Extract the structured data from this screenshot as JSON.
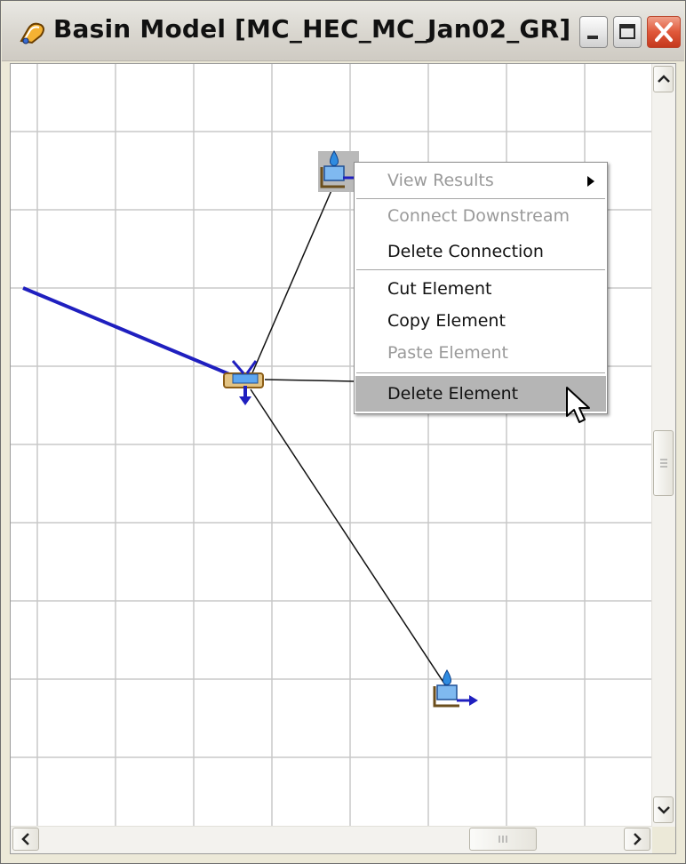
{
  "window": {
    "title": "Basin Model [MC_HEC_MC_Jan02_GR]",
    "icon": "basin-model-icon"
  },
  "titlebar_buttons": [
    {
      "name": "minimize-button",
      "icon": "minimize-icon"
    },
    {
      "name": "maximize-button",
      "icon": "maximize-icon"
    },
    {
      "name": "close-button",
      "icon": "close-icon"
    }
  ],
  "canvas": {
    "grid_color": "#c8c8c8",
    "elements": [
      {
        "name": "subbasin-element-top",
        "icon": "subbasin-icon"
      },
      {
        "name": "junction-element",
        "icon": "junction-icon"
      },
      {
        "name": "subbasin-element-bottom",
        "icon": "subbasin-icon"
      }
    ]
  },
  "context_menu": {
    "items": [
      {
        "label": "View Results",
        "enabled": false,
        "submenu": true
      },
      {
        "label": "Connect Downstream",
        "enabled": false
      },
      {
        "label": "Delete Connection",
        "enabled": true
      },
      {
        "label": "Cut Element",
        "enabled": true
      },
      {
        "label": "Copy Element",
        "enabled": true
      },
      {
        "label": "Paste Element",
        "enabled": false
      },
      {
        "label": "Delete Element",
        "enabled": true,
        "highlighted": true
      }
    ]
  },
  "colors": {
    "reach_blue": "#1f1fbf",
    "menu_highlight": "#b5b5b5"
  }
}
